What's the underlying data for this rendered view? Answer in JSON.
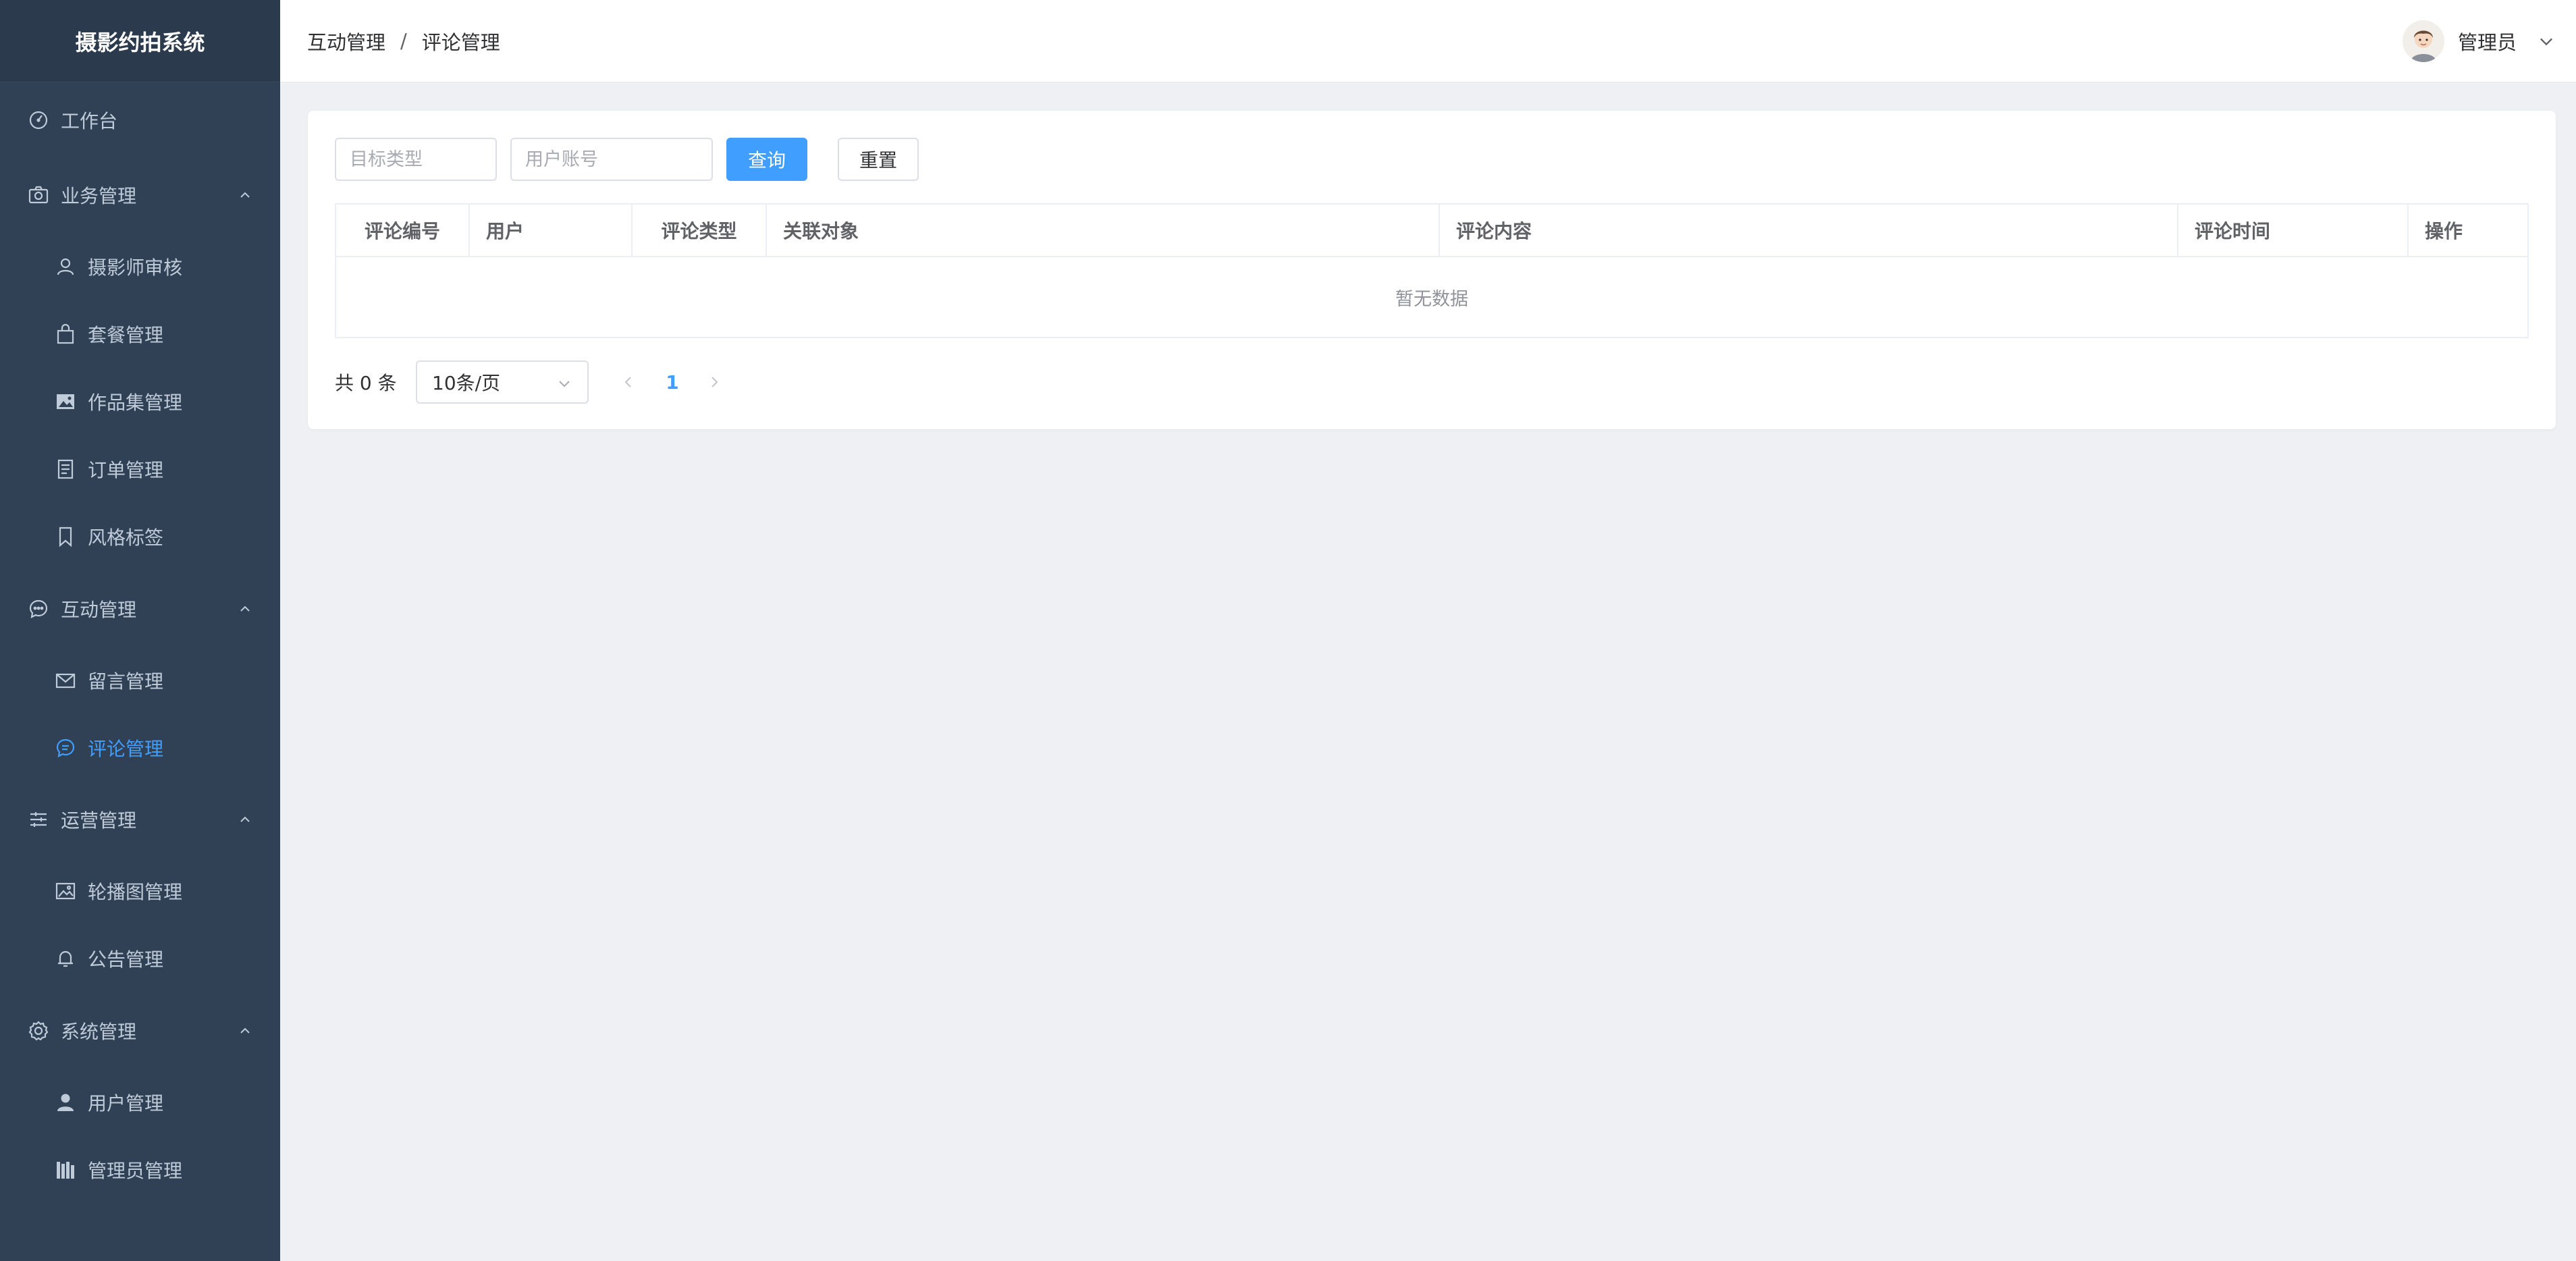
{
  "app": {
    "title": "摄影约拍系统"
  },
  "sidebar": {
    "workbench": "工作台",
    "groups": [
      {
        "label": "业务管理",
        "items": [
          "摄影师审核",
          "套餐管理",
          "作品集管理",
          "订单管理",
          "风格标签"
        ]
      },
      {
        "label": "互动管理",
        "items": [
          "留言管理",
          "评论管理"
        ]
      },
      {
        "label": "运营管理",
        "items": [
          "轮播图管理",
          "公告管理"
        ]
      },
      {
        "label": "系统管理",
        "items": [
          "用户管理",
          "管理员管理"
        ]
      }
    ],
    "active_item": "评论管理",
    "active_color": "#409EFF"
  },
  "header": {
    "breadcrumb": [
      "互动管理",
      "评论管理"
    ],
    "breadcrumb_sep": "/",
    "user_name": "管理员"
  },
  "filters": {
    "target_type_placeholder": "目标类型",
    "user_account_placeholder": "用户账号",
    "search_label": "查询",
    "reset_label": "重置"
  },
  "table": {
    "columns": [
      "评论编号",
      "用户",
      "评论类型",
      "关联对象",
      "评论内容",
      "评论时间",
      "操作"
    ],
    "rows": [],
    "empty_text": "暂无数据"
  },
  "pagination": {
    "total_text": "共 0 条",
    "page_size": "10条/页",
    "current_page": "1"
  }
}
